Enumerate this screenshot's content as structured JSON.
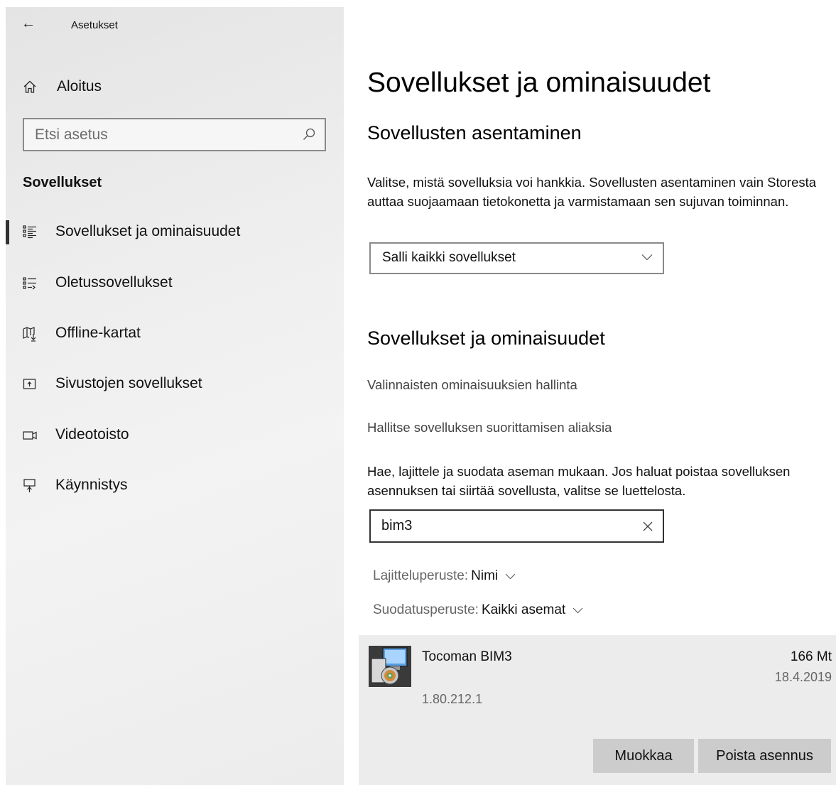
{
  "window": {
    "title": "Asetukset"
  },
  "sidebar": {
    "home_label": "Aloitus",
    "search_placeholder": "Etsi asetus",
    "section_heading": "Sovellukset",
    "items": [
      {
        "label": "Sovellukset ja ominaisuudet",
        "icon": "apps-list-icon",
        "selected": true
      },
      {
        "label": "Oletussovellukset",
        "icon": "default-apps-icon",
        "selected": false
      },
      {
        "label": "Offline-kartat",
        "icon": "map-icon",
        "selected": false
      },
      {
        "label": "Sivustojen sovellukset",
        "icon": "website-apps-icon",
        "selected": false
      },
      {
        "label": "Videotoisto",
        "icon": "video-icon",
        "selected": false
      },
      {
        "label": "Käynnistys",
        "icon": "startup-icon",
        "selected": false
      }
    ]
  },
  "main": {
    "title": "Sovellukset ja ominaisuudet",
    "install_section": {
      "heading": "Sovellusten asentaminen",
      "description": "Valitse, mistä sovelluksia voi hankkia. Sovellusten asentaminen vain Storesta auttaa suojaamaan tietokonetta ja varmistamaan sen sujuvan toiminnan.",
      "dropdown_value": "Salli kaikki sovellukset"
    },
    "apps_section": {
      "heading": "Sovellukset ja ominaisuudet",
      "link_optional_features": "Valinnaisten ominaisuuksien hallinta",
      "link_aliases": "Hallitse sovelluksen suorittamisen aliaksia",
      "description": "Hae, lajittele ja suodata aseman mukaan. Jos haluat poistaa sovelluksen asennuksen tai siirtää sovellusta, valitse se luettelosta.",
      "search_value": "bim3",
      "sort_label": "Lajitteluperuste:",
      "sort_value": "Nimi",
      "filter_label": "Suodatusperuste:",
      "filter_value": "Kaikki asemat"
    },
    "app": {
      "name": "Tocoman BIM3",
      "size": "166 Mt",
      "date": "18.4.2019",
      "version": "1.80.212.1",
      "modify_label": "Muokkaa",
      "uninstall_label": "Poista asennus"
    }
  }
}
